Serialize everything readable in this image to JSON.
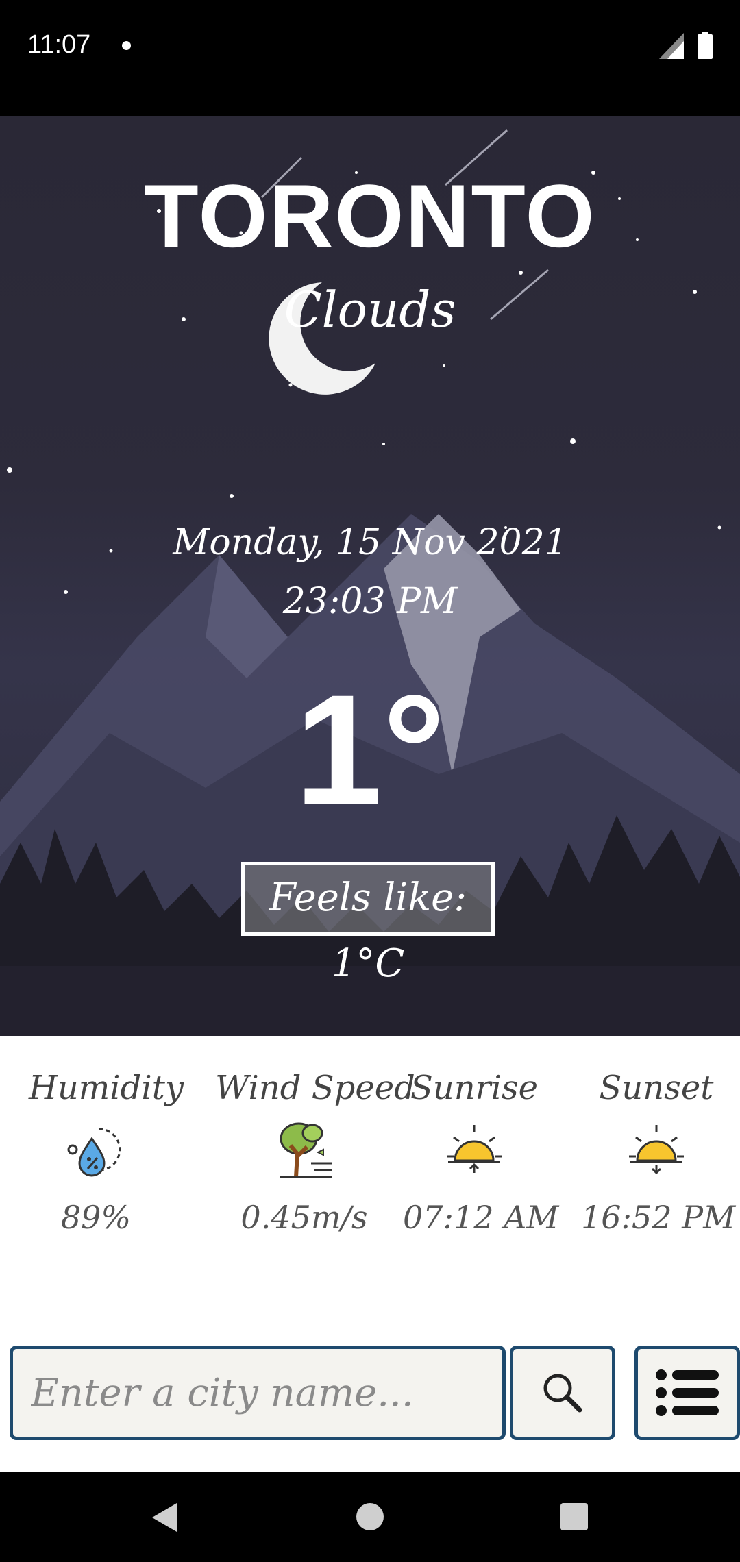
{
  "status_bar": {
    "time": "11:07"
  },
  "weather": {
    "city": "TORONTO",
    "condition": "Clouds",
    "date": "Monday, 15 Nov 2021",
    "time": "23:03 PM",
    "temperature": "1°",
    "feels_like": "Feels like: 1°C"
  },
  "details": {
    "stats": [
      {
        "label": "Humidity",
        "value": "89%",
        "icon": "humidity-icon"
      },
      {
        "label": "Wind Speed",
        "value": "0.45m/s",
        "icon": "wind-tree-icon"
      },
      {
        "label": "Sunrise",
        "value": "07:12 AM",
        "icon": "sunrise-icon"
      },
      {
        "label": "Sunset",
        "value": "16:52 PM",
        "icon": "sunset-icon"
      }
    ]
  },
  "search": {
    "placeholder": "Enter a city name..."
  },
  "colors": {
    "sky": "#2d2b3b",
    "input_border": "#1e4a6e",
    "input_bg": "#f4f3ef",
    "sun": "#f7c52e"
  }
}
